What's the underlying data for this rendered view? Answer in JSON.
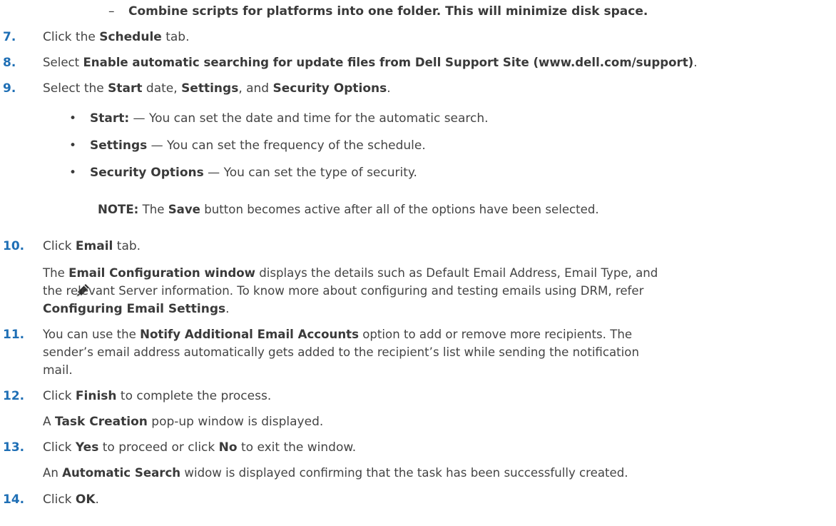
{
  "top_item": {
    "marker": "–",
    "text": "Combine scripts for platforms into one folder. This will minimize disk space."
  },
  "steps": [
    {
      "num": "7.",
      "parts": [
        "Click the ",
        "Schedule",
        " tab."
      ]
    },
    {
      "num": "8.",
      "parts": [
        "Select ",
        "Enable automatic searching for update files from Dell Support Site (www.dell.com/support)",
        "."
      ]
    },
    {
      "num": "9.",
      "parts": [
        "Select the ",
        "Start",
        " date, ",
        "Settings",
        ", and ",
        "Security Options",
        "."
      ]
    },
    {
      "num": "10.",
      "parts": [
        "Click ",
        "Email",
        " tab."
      ]
    },
    {
      "num": "11.",
      "parts": [
        "You can use the ",
        "Notify Additional Email Accounts",
        " option to add or remove more recipients. The"
      ]
    },
    {
      "num": "12.",
      "parts": [
        "Click ",
        "Finish",
        " to complete the process."
      ]
    },
    {
      "num": "13.",
      "parts": [
        "Click ",
        "Yes",
        " to proceed or click ",
        "No",
        " to exit the window."
      ]
    },
    {
      "num": "14.",
      "parts": [
        "Click ",
        "OK",
        "."
      ]
    }
  ],
  "bullets": [
    {
      "bold": "Start:",
      "text": " — You can set the date and time for the automatic search."
    },
    {
      "bold": "Settings",
      "text": " — You can set the frequency of the schedule."
    },
    {
      "bold": "Security Options",
      "text": " — You can set the type of security."
    }
  ],
  "note": {
    "label": "NOTE:",
    "pre": " The ",
    "bold": "Save",
    "post": " button becomes active after all of the options have been selected."
  },
  "email_para": {
    "pre": "The ",
    "bold1": "Email Configuration window",
    "line1_post": " displays the details such as Default Email Address, Email Type, and",
    "line2": "the relevant Server information. To know more about configuring and testing emails using DRM, refer",
    "bold2": "Configuring Email Settings",
    "line3_post": "."
  },
  "step11_cont": {
    "line2": "sender’s email address automatically gets added to the recipient’s list while sending the notification",
    "line3": "mail."
  },
  "step12_sub": {
    "pre": "A ",
    "bold": "Task Creation",
    "post": " pop-up window is displayed."
  },
  "step13_sub": {
    "pre": "An ",
    "bold": "Automatic Search",
    "post": " widow is displayed confirming that the task has been successfully created."
  }
}
